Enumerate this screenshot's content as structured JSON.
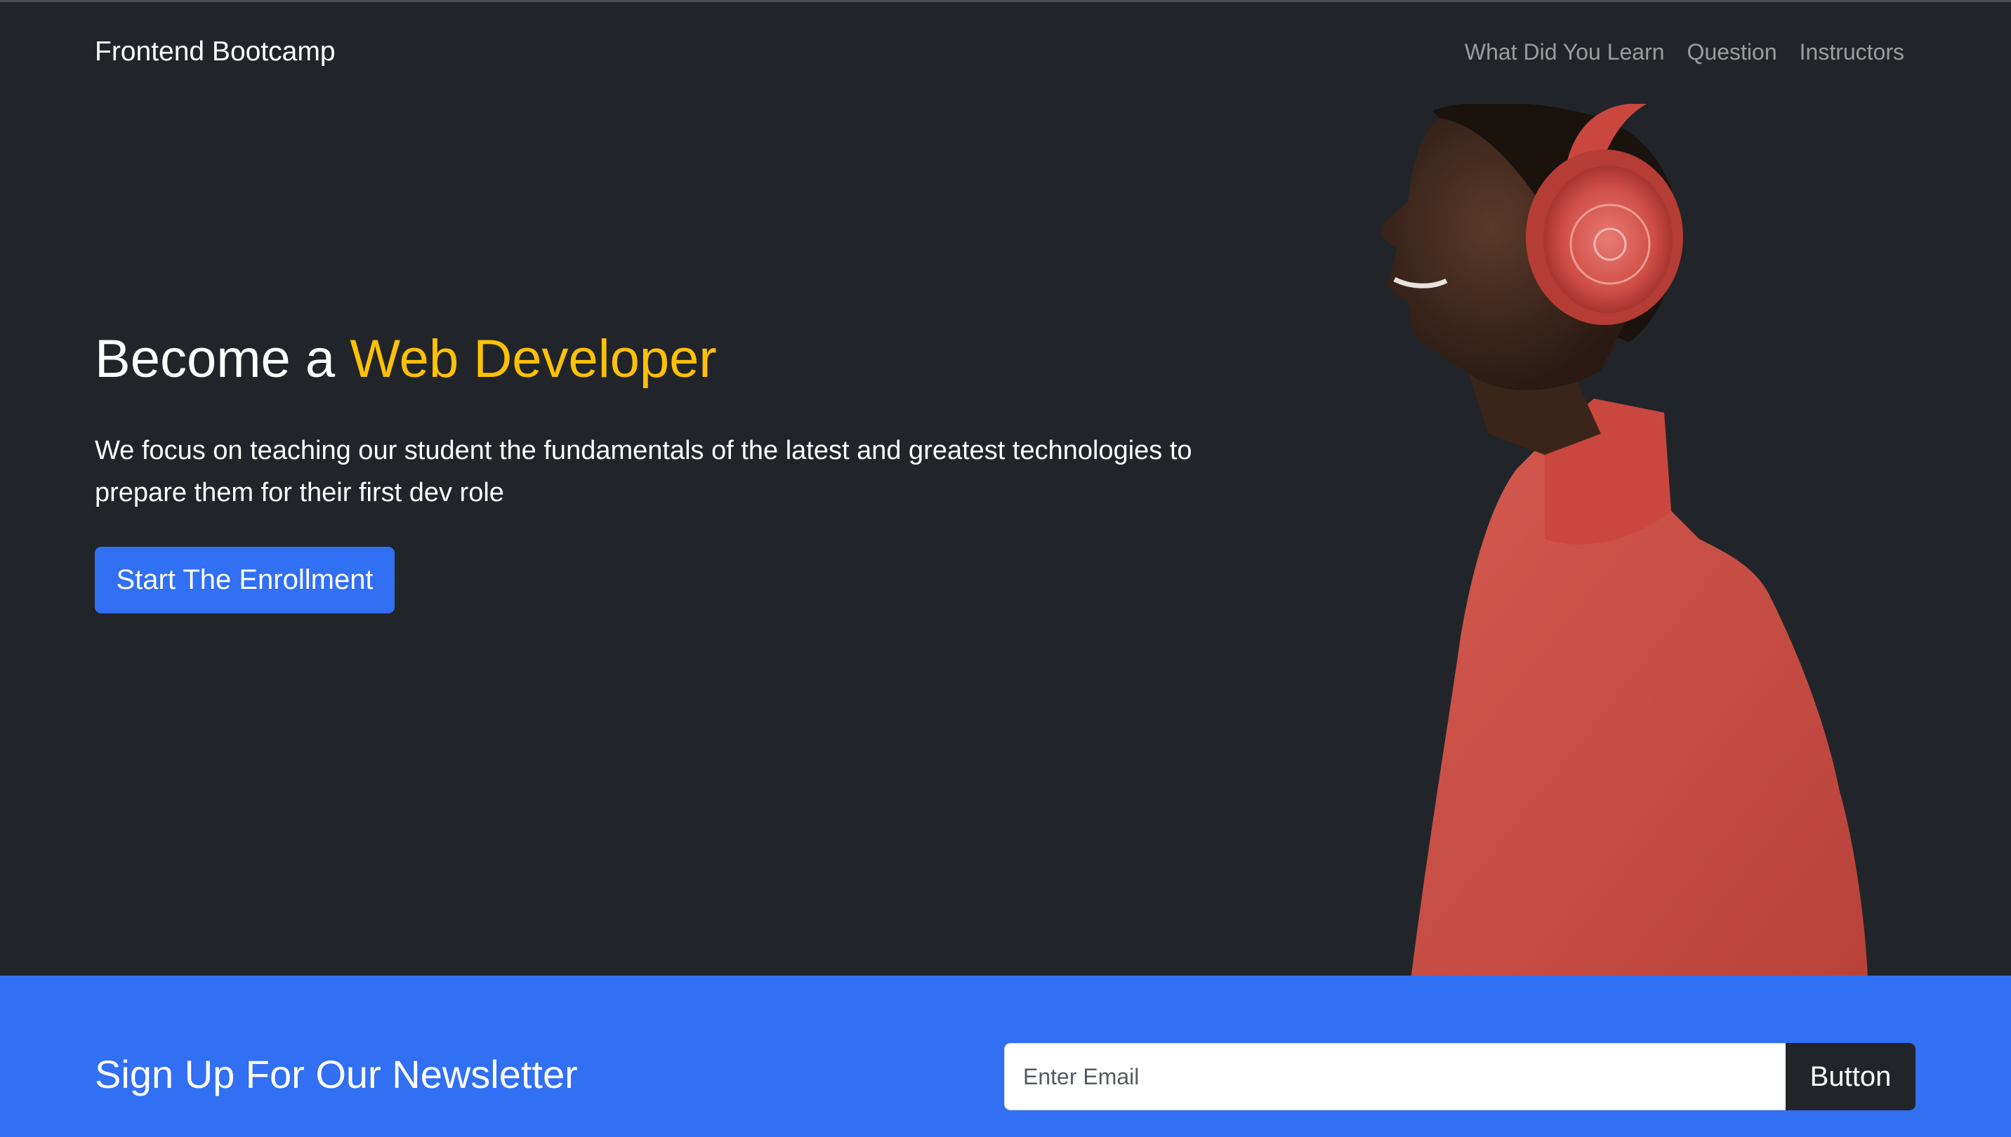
{
  "navbar": {
    "brand": "Frontend Bootcamp",
    "links": [
      "What Did You Learn",
      "Question",
      "Instructors"
    ]
  },
  "hero": {
    "title_prefix": "Become a ",
    "title_accent": "Web Developer",
    "description": "We focus on teaching our student the fundamentals of the latest and greatest technologies to prepare them for their first dev role",
    "cta_label": "Start The Enrollment",
    "image": "man-with-red-headphones-photo"
  },
  "newsletter": {
    "title": "Sign Up For Our Newsletter",
    "email_placeholder": "Enter Email",
    "email_value": "",
    "button_label": "Button"
  },
  "colors": {
    "background": "#212529",
    "accent": "#ffc107",
    "primary": "#316ff3",
    "nav_link": "rgba(255,255,255,0.55)"
  }
}
